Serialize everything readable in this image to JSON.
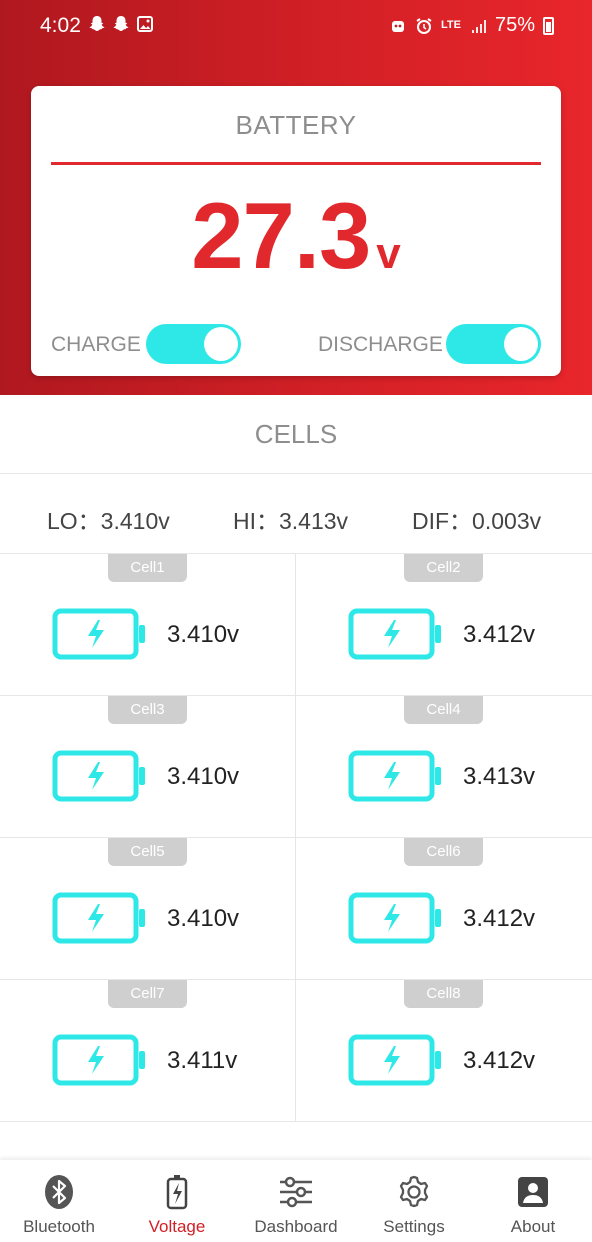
{
  "status": {
    "time": "4:02",
    "network": "LTE",
    "battery_pct": "75%"
  },
  "battery": {
    "title": "BATTERY",
    "voltage": "27.3",
    "unit": "v",
    "charge_label": "CHARGE",
    "discharge_label": "DISCHARGE",
    "charge_on": true,
    "discharge_on": true
  },
  "cells_title": "CELLS",
  "summary": {
    "lo": "LO：3.410v",
    "hi": "HI：3.413v",
    "dif": "DIF：0.003v"
  },
  "cells": [
    {
      "name": "Cell1",
      "value": "3.410v"
    },
    {
      "name": "Cell2",
      "value": "3.412v"
    },
    {
      "name": "Cell3",
      "value": "3.410v"
    },
    {
      "name": "Cell4",
      "value": "3.413v"
    },
    {
      "name": "Cell5",
      "value": "3.410v"
    },
    {
      "name": "Cell6",
      "value": "3.412v"
    },
    {
      "name": "Cell7",
      "value": "3.411v"
    },
    {
      "name": "Cell8",
      "value": "3.412v"
    }
  ],
  "nav": [
    {
      "label": "Bluetooth",
      "icon": "bluetooth-icon"
    },
    {
      "label": "Voltage",
      "icon": "battery-voltage-icon",
      "active": true
    },
    {
      "label": "Dashboard",
      "icon": "sliders-icon"
    },
    {
      "label": "Settings",
      "icon": "gear-icon"
    },
    {
      "label": "About",
      "icon": "person-icon"
    }
  ],
  "colors": {
    "accent": "#d22026",
    "toggle": "#2ee8e8",
    "cell_icon": "#2ee8e8"
  }
}
